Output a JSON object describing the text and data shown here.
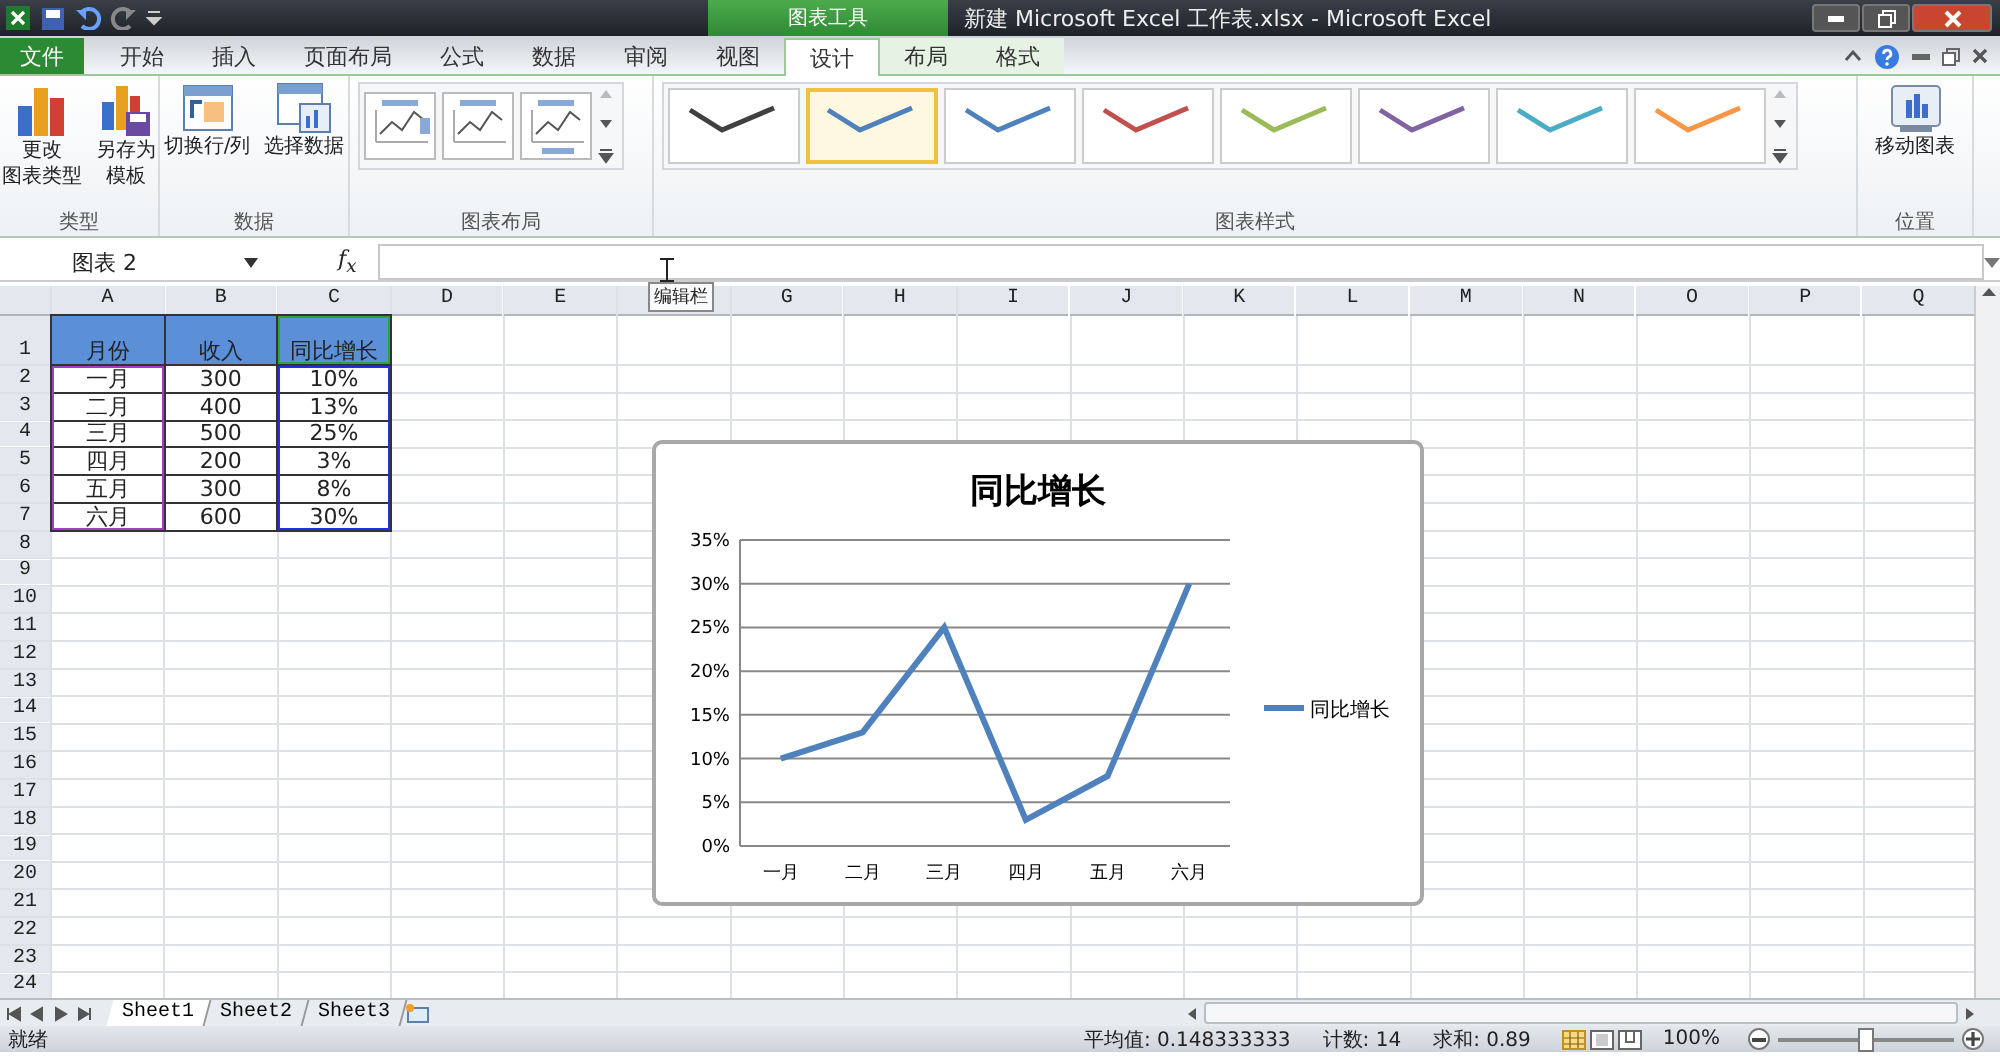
{
  "window": {
    "title": "新建 Microsoft Excel 工作表.xlsx - Microsoft Excel",
    "contextual_group": "图表工具"
  },
  "tabs": [
    {
      "label": "文件",
      "kind": "file",
      "selected": false
    },
    {
      "label": "开始",
      "kind": "tab",
      "selected": false
    },
    {
      "label": "插入",
      "kind": "tab",
      "selected": false
    },
    {
      "label": "页面布局",
      "kind": "tab",
      "selected": false
    },
    {
      "label": "公式",
      "kind": "tab",
      "selected": false
    },
    {
      "label": "数据",
      "kind": "tab",
      "selected": false
    },
    {
      "label": "审阅",
      "kind": "tab",
      "selected": false
    },
    {
      "label": "视图",
      "kind": "tab",
      "selected": false
    },
    {
      "label": "设计",
      "kind": "context",
      "selected": true
    },
    {
      "label": "布局",
      "kind": "context",
      "selected": false
    },
    {
      "label": "格式",
      "kind": "context",
      "selected": false
    }
  ],
  "ribbon": {
    "groups": [
      {
        "label": "类型",
        "kind": "buttons",
        "buttons": [
          {
            "lines": [
              "更改",
              "图表类型"
            ]
          },
          {
            "lines": [
              "另存为",
              "模板"
            ]
          }
        ]
      },
      {
        "label": "数据",
        "kind": "buttons",
        "buttons": [
          {
            "lines": [
              "切换行/列"
            ]
          },
          {
            "lines": [
              "选择数据"
            ]
          }
        ]
      },
      {
        "label": "图表布局",
        "kind": "layouts"
      },
      {
        "label": "图表样式",
        "kind": "styles",
        "styles": [
          {
            "color": "#404040",
            "selected": false
          },
          {
            "color": "#4f81bd",
            "selected": true
          },
          {
            "color": "#4f81bd",
            "selected": false
          },
          {
            "color": "#c0504d",
            "selected": false
          },
          {
            "color": "#9bbb59",
            "selected": false
          },
          {
            "color": "#8064a2",
            "selected": false
          },
          {
            "color": "#4bacc6",
            "selected": false
          },
          {
            "color": "#f79646",
            "selected": false
          }
        ]
      },
      {
        "label": "位置",
        "kind": "buttons",
        "buttons": [
          {
            "lines": [
              "移动图表"
            ]
          }
        ]
      }
    ]
  },
  "formula_bar": {
    "name_box": "图表 2",
    "fx_label": "f$_{x}$",
    "tooltip": "编辑栏"
  },
  "sheet": {
    "columns": [
      "A",
      "B",
      "C",
      "D",
      "E",
      null,
      "G",
      "H",
      "I",
      "J",
      "K",
      "L",
      "M",
      "N",
      "O",
      "P",
      "Q"
    ],
    "rows": [
      "1",
      "2",
      "3",
      "4",
      "5",
      "6",
      "7",
      "8",
      "9",
      "10",
      "11",
      "12",
      "13",
      "14",
      "15",
      "16",
      "17",
      "18",
      "19",
      "20",
      "21",
      "22",
      "23",
      "24"
    ],
    "cells": [
      [
        "月份",
        "收入",
        "同比增长"
      ],
      [
        "一月",
        "300",
        "10%"
      ],
      [
        "二月",
        "400",
        "13%"
      ],
      [
        "三月",
        "500",
        "25%"
      ],
      [
        "四月",
        "200",
        "3%"
      ],
      [
        "五月",
        "300",
        "8%"
      ],
      [
        "六月",
        "600",
        "30%"
      ]
    ],
    "highlights": [
      {
        "kind": "categories",
        "color": "#a040c0"
      },
      {
        "kind": "series_name",
        "color": "#30a040"
      },
      {
        "kind": "values",
        "color": "#2030e0"
      }
    ]
  },
  "chart": {
    "chart_data": {
      "type": "line",
      "title": "同比增长",
      "categories": [
        "一月",
        "二月",
        "三月",
        "四月",
        "五月",
        "六月"
      ],
      "series": [
        {
          "name": "同比增长",
          "color": "#4f81bd",
          "values": [
            10,
            13,
            25,
            3,
            8,
            30
          ]
        }
      ],
      "ylim": [
        0,
        35
      ],
      "grid": true,
      "yticks": [
        {
          "value": 0,
          "label": "0%"
        },
        {
          "value": 5,
          "label": "5%"
        },
        {
          "value": 10,
          "label": "10%"
        },
        {
          "value": 15,
          "label": "15%"
        },
        {
          "value": 20,
          "label": "20%"
        },
        {
          "value": 25,
          "label": "25%"
        },
        {
          "value": 30,
          "label": "30%"
        },
        {
          "value": 35,
          "label": "35%"
        }
      ]
    }
  },
  "sheet_tabs": [
    {
      "label": "Sheet1",
      "selected": true
    },
    {
      "label": "Sheet2",
      "selected": false
    },
    {
      "label": "Sheet3",
      "selected": false
    }
  ],
  "status_bar": {
    "state": "就绪",
    "average": "平均值: 0.148333333",
    "count": "计数: 14",
    "sum": "求和: 0.89",
    "zoom": {
      "reading": "100%",
      "level": 0.5
    }
  }
}
